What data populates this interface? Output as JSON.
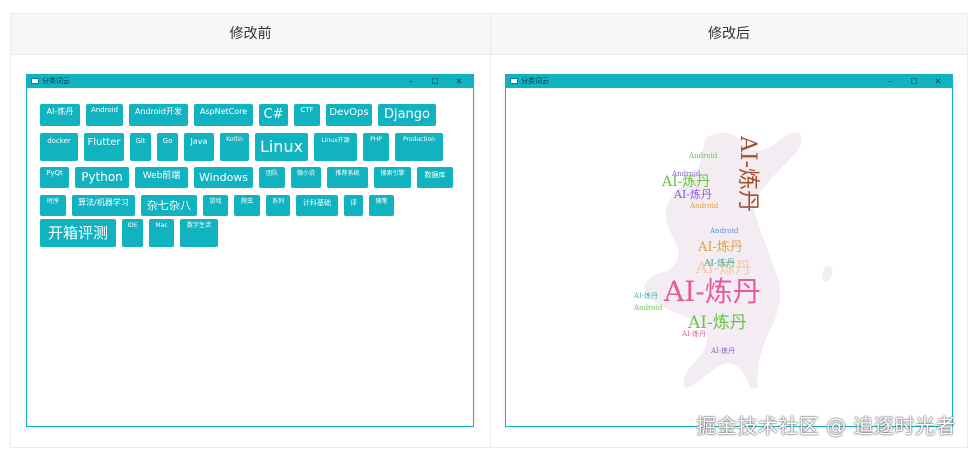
{
  "table": {
    "before_header": "修改前",
    "after_header": "修改后"
  },
  "window": {
    "title": "分类词云",
    "minimize_glyph": "–",
    "maximize_glyph": "☐",
    "close_glyph": "✕"
  },
  "tags": [
    "AI-炼丹",
    "Android",
    "Android开发",
    "AspNetCore",
    "C#",
    "CTF",
    "DevOps",
    "Django",
    "docker",
    "Flutter",
    "Git",
    "Go",
    "Java",
    "Kotlin",
    "Linux",
    "Linux开源",
    "PHP",
    "Production",
    "PyQt",
    "Python",
    "Web前端",
    "Windows",
    "团队",
    "微小说",
    "推荐系统",
    "搜索引擎",
    "数据库",
    "时序",
    "算法/机器学习",
    "杂七杂八",
    "游戏",
    "爬虫",
    "系列",
    "计科基础",
    "评",
    "随笔",
    "开箱评测",
    "IDE",
    "Mac",
    "数字生活"
  ],
  "cloud_words": {
    "big": "AI-炼丹",
    "big2": "AI-炼丹",
    "vertical": "AI-炼丹",
    "mid1": "AI-炼丹",
    "mid2": "AI-炼丹",
    "mid3": "AI-炼丹",
    "mid4": "AI-炼丹",
    "mid5": "AI-炼丹",
    "small1": "Android",
    "small2": "Android",
    "small3": "Android",
    "small4": "Android",
    "small5": "AI-炼丹",
    "small6": "AI-炼丹",
    "small7": "Android",
    "small8": "AI-炼丹"
  },
  "watermark": "掘金技术社区 @ 追逐时光者",
  "colors": {
    "accent": "#12b3c0",
    "cloud_pink": "#e65a9c",
    "cloud_green": "#6cc04a",
    "cloud_purple": "#8a5cd6",
    "cloud_brown": "#a0522d",
    "cloud_blue": "#5a8fd6",
    "cloud_orange": "#e6a03a",
    "cloud_teal": "#3ab5a8"
  }
}
